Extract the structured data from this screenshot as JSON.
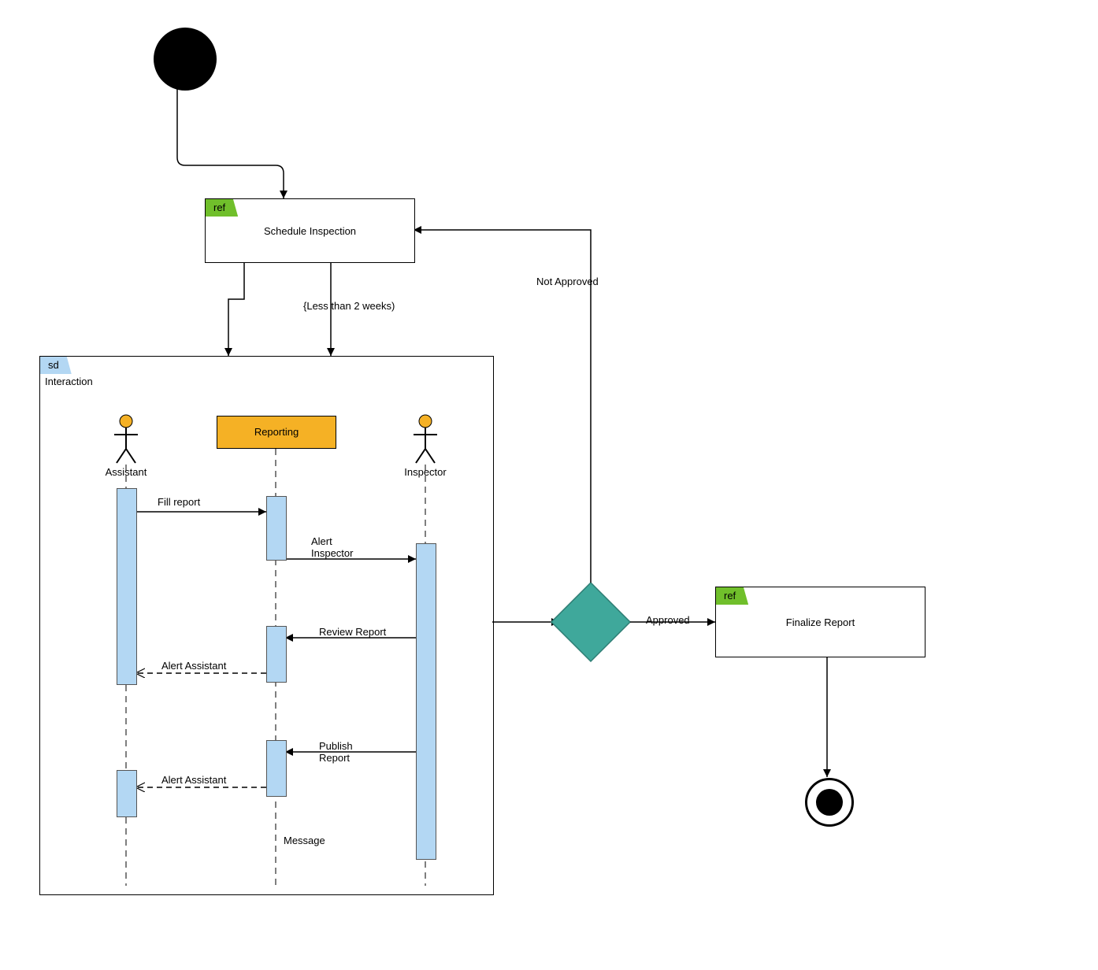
{
  "initial_node": {
    "name": "initial-node"
  },
  "schedule_inspection": {
    "tab": "ref",
    "title": "Schedule Inspection"
  },
  "constraint_label": "{Less than 2 weeks)",
  "interaction_frame": {
    "tab": "sd",
    "title": "Interaction",
    "actors": {
      "assistant": "Assistant",
      "inspector": "Inspector"
    },
    "reporting_label": "Reporting",
    "messages": {
      "fill_report": "Fill report",
      "alert_inspector": "Alert\nInspector",
      "review_report": "Review Report",
      "alert_assistant_1": "Alert Assistant",
      "publish_report": "Publish\nReport",
      "alert_assistant_2": "Alert Assistant",
      "message": "Message"
    }
  },
  "decision": {
    "approved_label": "Approved",
    "not_approved_label": "Not Approved"
  },
  "finalize_report": {
    "tab": "ref",
    "title": "Finalize Report"
  },
  "colors": {
    "tab_green": "#70bf2b",
    "tab_blue": "#b3d7f3",
    "reporting": "#f5b125",
    "decision": "#3fa89b",
    "lifeline": "#b3d7f3"
  }
}
